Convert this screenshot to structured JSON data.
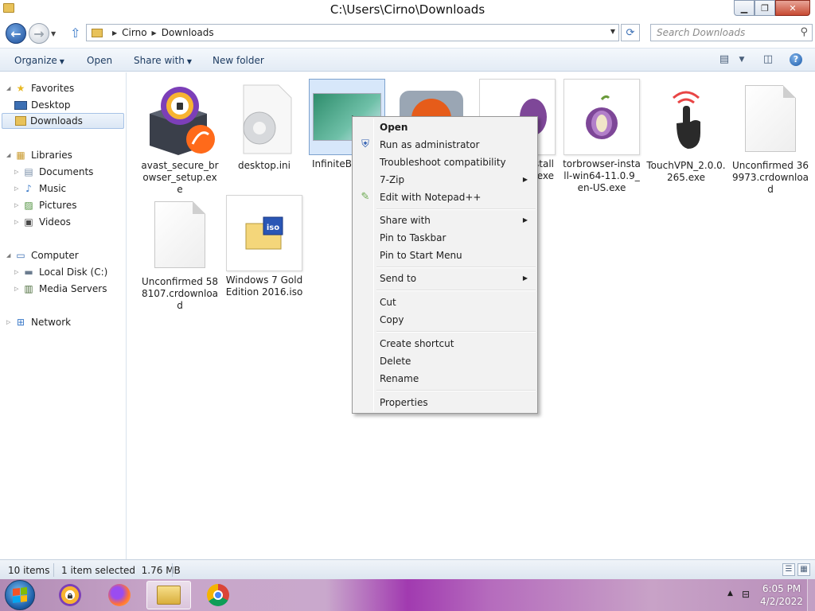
{
  "window": {
    "title": "C:\\Users\\Cirno\\Downloads",
    "controls": {
      "minimize": "▁",
      "maximize": "❐",
      "close": "✕"
    }
  },
  "address": {
    "crumbs": [
      "Cirno",
      "Downloads"
    ],
    "search_placeholder": "Search Downloads"
  },
  "command_bar": {
    "organize": "Organize",
    "open": "Open",
    "share_with": "Share with",
    "new_folder": "New folder"
  },
  "nav": {
    "favorites": "Favorites",
    "desktop": "Desktop",
    "downloads": "Downloads",
    "libraries": "Libraries",
    "documents": "Documents",
    "music": "Music",
    "pictures": "Pictures",
    "videos": "Videos",
    "computer": "Computer",
    "local_disk": "Local Disk (C:)",
    "media_servers": "Media Servers",
    "network": "Network"
  },
  "files": [
    {
      "name": "avast_secure_browser_setup.exe",
      "icon": "avast-icon"
    },
    {
      "name": "desktop.ini",
      "icon": "settings-file-icon"
    },
    {
      "name": "InfiniteBl",
      "icon": "image-thumbnail"
    },
    {
      "name": "",
      "icon": "orange-app-icon"
    },
    {
      "name": "stall\n.exe",
      "icon": "tor-installer-icon"
    },
    {
      "name": "torbrowser-install-win64-11.0.9_en-US.exe",
      "icon": "tor-onion-icon"
    },
    {
      "name": "TouchVPN_2.0.0.265.exe",
      "icon": "touchvpn-icon"
    },
    {
      "name": "Unconfirmed 369973.crdownload",
      "icon": "blank-file-icon"
    },
    {
      "name": "Unconfirmed 588107.crdownload",
      "icon": "blank-file-icon"
    },
    {
      "name": "Windows 7 Gold Edition 2016.iso",
      "icon": "iso-file-icon"
    }
  ],
  "context_menu": {
    "open": "Open",
    "run_as_admin": "Run as administrator",
    "troubleshoot": "Troubleshoot compatibility",
    "seven_zip": "7-Zip",
    "edit_notepad": "Edit with Notepad++",
    "share_with": "Share with",
    "pin_taskbar": "Pin to Taskbar",
    "pin_start": "Pin to Start Menu",
    "send_to": "Send to",
    "cut": "Cut",
    "copy": "Copy",
    "create_shortcut": "Create shortcut",
    "delete": "Delete",
    "rename": "Rename",
    "properties": "Properties"
  },
  "status": {
    "items": "10 items",
    "selected": "1 item selected  1.76 MB"
  },
  "taskbar": {
    "apps": [
      "avast-browser-icon",
      "firefox-icon",
      "explorer-icon",
      "chrome-icon"
    ],
    "time": "6:05 PM",
    "date": "4/2/2022"
  }
}
